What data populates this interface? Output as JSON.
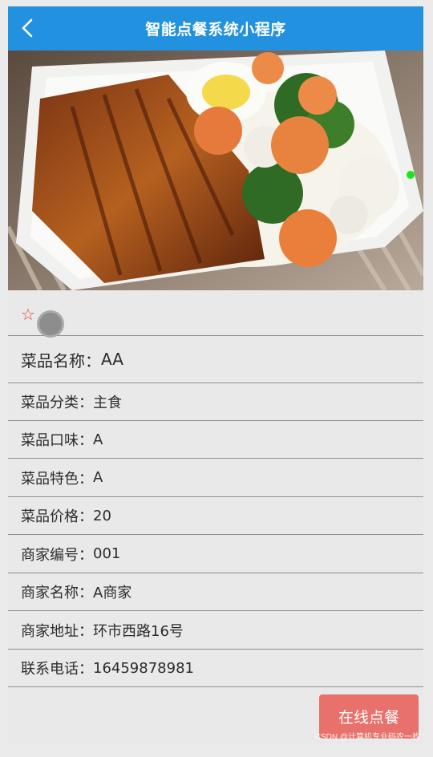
{
  "header": {
    "title": "智能点餐系统小程序",
    "back_icon": "chevron-left-icon"
  },
  "hero": {
    "image_description_icon": "food-photo",
    "carousel_indicator_color": "#19e619"
  },
  "favorite": {
    "icon": "star-outline-icon",
    "glyph": "☆",
    "color": "#e13c32"
  },
  "details": [
    {
      "label": "菜品名称：",
      "value": "AA"
    },
    {
      "label": "菜品分类：",
      "value": "主食"
    },
    {
      "label": "菜品口味：",
      "value": "A"
    },
    {
      "label": "菜品特色：",
      "value": "A"
    },
    {
      "label": "菜品价格：",
      "value": "20"
    },
    {
      "label": "商家编号：",
      "value": "001"
    },
    {
      "label": "商家名称：",
      "value": "A商家"
    },
    {
      "label": "商家地址：",
      "value": "环市西路16号"
    },
    {
      "label": "联系电话：",
      "value": "16459878981"
    }
  ],
  "actions": {
    "order_label": "在线点餐",
    "order_color": "#e8716b"
  },
  "colors": {
    "header": "#2291e0",
    "background": "#e9e9e9"
  },
  "watermark": "CSDN @计算机专业码农一枚"
}
